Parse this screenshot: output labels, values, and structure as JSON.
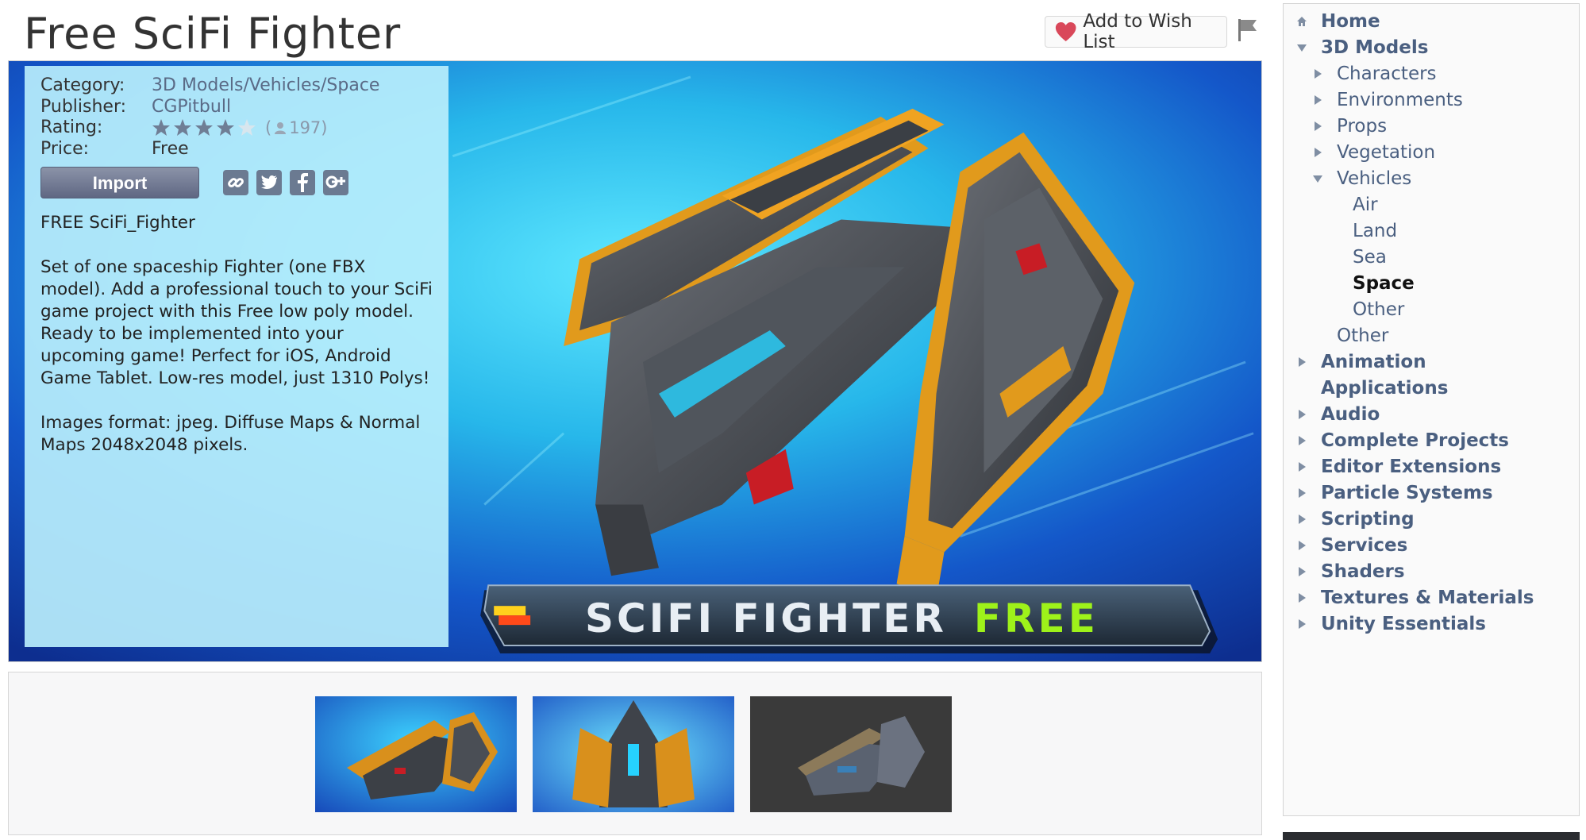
{
  "header": {
    "title": "Free SciFi Fighter",
    "wishlist_label": "Add to Wish List"
  },
  "details": {
    "category_key": "Category:",
    "category_value": "3D Models/Vehicles/Space",
    "publisher_key": "Publisher:",
    "publisher_value": "CGPitbull",
    "rating_key": "Rating:",
    "rating_stars": 4,
    "rating_max": 5,
    "rating_count_open": "(",
    "rating_count": "197)",
    "price_key": "Price:",
    "price_value": "Free",
    "import_label": "Import"
  },
  "description": [
    "FREE SciFi_Fighter",
    "Set of one spaceship Fighter (one FBX model). Add a professional touch to your SciFi game project with this Free low poly model. Ready to be implemented into your upcoming game! Perfect for iOS, Android Game Tablet. Low-res model, just 1310 Polys!",
    "Images format: jpeg. Diffuse Maps & Normal Maps 2048x2048 pixels."
  ],
  "banner": {
    "text": "SCIFI FIGHTER",
    "free": "FREE"
  },
  "sidebar": {
    "items": [
      {
        "label": "Home",
        "level": 0,
        "bold": true,
        "icon": "home-icon"
      },
      {
        "label": "3D Models",
        "level": 0,
        "bold": true,
        "icon": "arrow-down"
      },
      {
        "label": "Characters",
        "level": 1,
        "bold": false,
        "icon": "arrow-right"
      },
      {
        "label": "Environments",
        "level": 1,
        "bold": false,
        "icon": "arrow-right"
      },
      {
        "label": "Props",
        "level": 1,
        "bold": false,
        "icon": "arrow-right"
      },
      {
        "label": "Vegetation",
        "level": 1,
        "bold": false,
        "icon": "arrow-right"
      },
      {
        "label": "Vehicles",
        "level": 1,
        "bold": false,
        "icon": "arrow-down"
      },
      {
        "label": "Air",
        "level": 2,
        "bold": false,
        "icon": ""
      },
      {
        "label": "Land",
        "level": 2,
        "bold": false,
        "icon": ""
      },
      {
        "label": "Sea",
        "level": 2,
        "bold": false,
        "icon": ""
      },
      {
        "label": "Space",
        "level": 2,
        "bold": false,
        "active": true,
        "icon": ""
      },
      {
        "label": "Other",
        "level": 2,
        "bold": false,
        "icon": ""
      },
      {
        "label": "Other",
        "level": 1,
        "bold": false,
        "icon": ""
      },
      {
        "label": "Animation",
        "level": 0,
        "bold": true,
        "icon": "arrow-right"
      },
      {
        "label": "Applications",
        "level": 0,
        "bold": true,
        "icon": ""
      },
      {
        "label": "Audio",
        "level": 0,
        "bold": true,
        "icon": "arrow-right"
      },
      {
        "label": "Complete Projects",
        "level": 0,
        "bold": true,
        "icon": "arrow-right"
      },
      {
        "label": "Editor Extensions",
        "level": 0,
        "bold": true,
        "icon": "arrow-right"
      },
      {
        "label": "Particle Systems",
        "level": 0,
        "bold": true,
        "icon": "arrow-right"
      },
      {
        "label": "Scripting",
        "level": 0,
        "bold": true,
        "icon": "arrow-right"
      },
      {
        "label": "Services",
        "level": 0,
        "bold": true,
        "icon": "arrow-right"
      },
      {
        "label": "Shaders",
        "level": 0,
        "bold": true,
        "icon": "arrow-right"
      },
      {
        "label": "Textures & Materials",
        "level": 0,
        "bold": true,
        "icon": "arrow-right"
      },
      {
        "label": "Unity Essentials",
        "level": 0,
        "bold": true,
        "icon": "arrow-right"
      }
    ]
  },
  "colors": {
    "link": "#4a5f80",
    "info_bg": "#b9eefc",
    "banner_free": "#9ef21a"
  }
}
